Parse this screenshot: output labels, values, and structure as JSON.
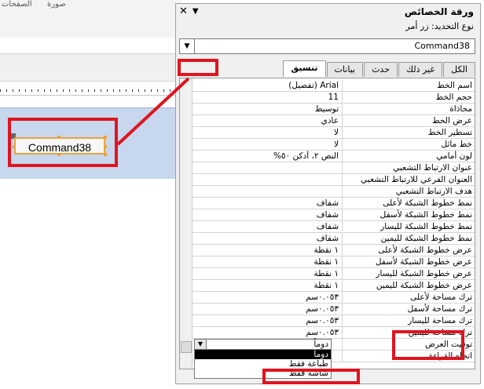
{
  "background": {
    "ribbon_labels": [
      "الصفحات",
      "صورة"
    ],
    "command_button_label": "Command38"
  },
  "panel": {
    "title": "ورقة الخصائص",
    "selection_type": "نوع التحديد:  زر أمر",
    "selector_value": "Command38",
    "tabs": [
      {
        "label": "الكل",
        "active": false
      },
      {
        "label": "غير ذلك",
        "active": false
      },
      {
        "label": "حدث",
        "active": false
      },
      {
        "label": "بيانات",
        "active": false
      },
      {
        "label": "تنسيق",
        "active": true
      }
    ],
    "properties": [
      {
        "label": "اسم الخط",
        "value": "Arial (تفصيل)"
      },
      {
        "label": "حجم الخط",
        "value": "11"
      },
      {
        "label": "محاذاة",
        "value": "توسيط"
      },
      {
        "label": "عرض الخط",
        "value": "عادي"
      },
      {
        "label": "تسطير الخط",
        "value": "لا"
      },
      {
        "label": "خط مائل",
        "value": "لا"
      },
      {
        "label": "لون أمامي",
        "value": "النص ٢، أدكن ٥٠%"
      },
      {
        "label": "عنوان الارتباط التشعبي",
        "value": ""
      },
      {
        "label": "العنوان الفرعي للارتباط التشعبي",
        "value": ""
      },
      {
        "label": "هدف الارتباط التشعبي",
        "value": ""
      },
      {
        "label": "نمط خطوط الشبكة لأعلى",
        "value": "شفاف"
      },
      {
        "label": "نمط خطوط الشبكة لأسفل",
        "value": "شفاف"
      },
      {
        "label": "نمط خطوط الشبكة لليسار",
        "value": "شفاف"
      },
      {
        "label": "نمط خطوط الشبكة لليمين",
        "value": "شفاف"
      },
      {
        "label": "عرض خطوط الشبكة لأعلى",
        "value": "١ نقطة"
      },
      {
        "label": "عرض خطوط الشبكة لأسفل",
        "value": "١ نقطة"
      },
      {
        "label": "عرض خطوط الشبكة لليسار",
        "value": "١ نقطة"
      },
      {
        "label": "عرض خطوط الشبكة لليمين",
        "value": "١ نقطة"
      },
      {
        "label": "ترك مساحة لأعلى",
        "value": "٠.٠٥٣سم"
      },
      {
        "label": "ترك مساحة لأسفل",
        "value": "٠.٠٥٣سم"
      },
      {
        "label": "ترك مساحة لليسار",
        "value": "٠.٠٥٣سم"
      },
      {
        "label": "ترك مساحة لليمين",
        "value": "٠.٠٥٣سم"
      },
      {
        "label": "توقيت العرض",
        "value": ""
      },
      {
        "label": "اتجاه القراءة",
        "value": ""
      }
    ],
    "display_when": {
      "current": "دوماً",
      "options": [
        "دوماً",
        "طباعة فقط",
        "شاشة فقط"
      ],
      "highlighted": 0
    }
  }
}
